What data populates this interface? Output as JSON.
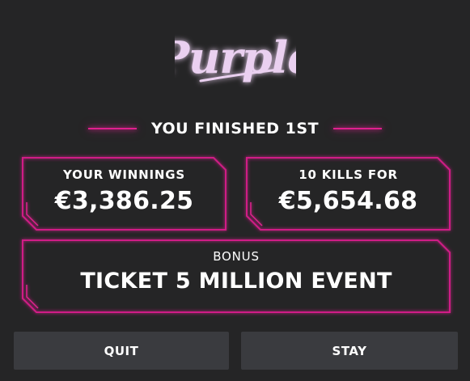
{
  "brand": {
    "logo_text": "Purple",
    "logo_color": "#ead0f0",
    "accent_color": "#e0208f",
    "background_color": "#252526"
  },
  "result": {
    "headline": "YOU FINISHED 1ST"
  },
  "winnings": {
    "label": "YOUR WINNINGS",
    "amount": "€3,386.25"
  },
  "kills": {
    "label": "10 KILLS FOR",
    "amount": "€5,654.68"
  },
  "bonus": {
    "label": "BONUS",
    "value": "TICKET 5 MILLION EVENT"
  },
  "actions": {
    "quit_label": "QUIT",
    "stay_label": "STAY",
    "button_color": "#3a3b3f"
  }
}
